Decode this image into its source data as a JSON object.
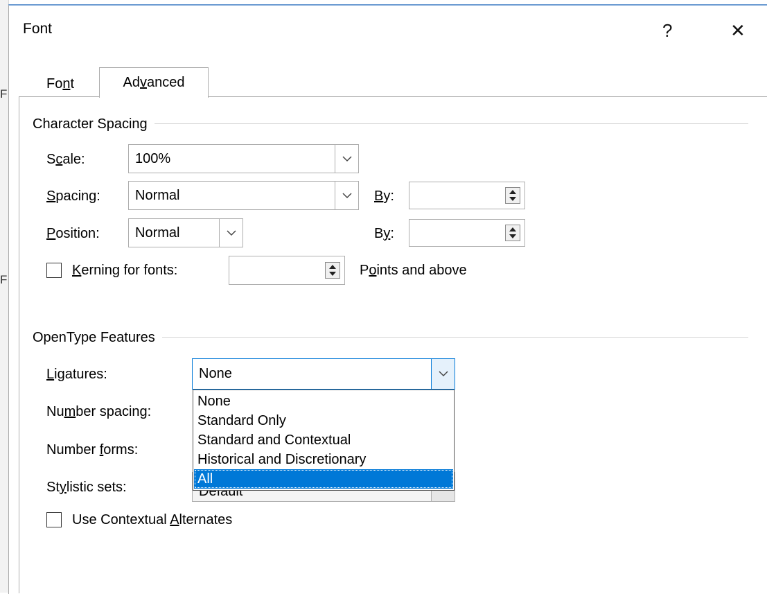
{
  "edge": {
    "letters": [
      "F",
      "F"
    ]
  },
  "dialog": {
    "title": "Font",
    "help_glyph": "?",
    "close_glyph": "✕",
    "tabs": [
      {
        "pre": "Fo",
        "u": "n",
        "post": "t",
        "active": false
      },
      {
        "pre": "Ad",
        "u": "v",
        "post": "anced",
        "active": true
      }
    ]
  },
  "character_spacing": {
    "title": "Character Spacing",
    "scale": {
      "pre": "S",
      "u": "c",
      "post": "ale:",
      "value": "100%"
    },
    "spacing": {
      "pre": "",
      "u": "S",
      "post": "pacing:",
      "value": "Normal"
    },
    "spacing_by": {
      "pre": "",
      "u": "B",
      "post": "y:",
      "value": ""
    },
    "position": {
      "pre": "",
      "u": "P",
      "post": "osition:",
      "value": "Normal"
    },
    "position_by": {
      "pre": "B",
      "u": "y",
      "post": ":",
      "value": ""
    },
    "kerning": {
      "pre": "",
      "u": "K",
      "post": "erning for fonts:",
      "value": "",
      "checked": false
    },
    "points_label": {
      "pre": "P",
      "u": "o",
      "post": "ints and above"
    }
  },
  "opentype": {
    "title": "OpenType Features",
    "ligatures": {
      "pre": "",
      "u": "L",
      "post": "igatures:",
      "value": "None"
    },
    "number_spacing": {
      "pre": "Nu",
      "u": "m",
      "post": "ber spacing:"
    },
    "number_forms": {
      "pre": "Number ",
      "u": "f",
      "post": "orms:"
    },
    "stylistic_sets": {
      "pre": "St",
      "u": "y",
      "post": "listic sets:",
      "value": "Default"
    },
    "contextual": {
      "pre": "Use Contextual ",
      "u": "A",
      "post": "lternates",
      "checked": false
    },
    "ligature_options": [
      "None",
      "Standard Only",
      "Standard and Contextual",
      "Historical and Discretionary",
      "All"
    ],
    "selected_option": "All"
  },
  "icons": {
    "chevron": "chevron-down-icon",
    "spin": "spin-up-down-icon",
    "close": "close-icon",
    "help": "help-icon"
  },
  "colors": {
    "selection": "#0078d7",
    "title_border": "#6c9bd2"
  }
}
